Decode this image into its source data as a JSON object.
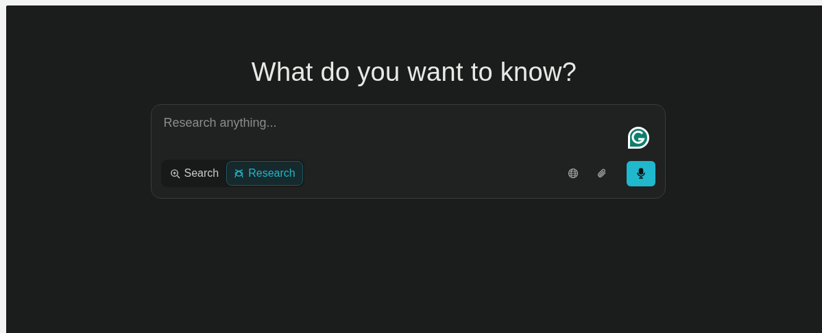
{
  "heading": "What do you want to know?",
  "query": {
    "placeholder": "Research anything..."
  },
  "modes": [
    {
      "label": "Search",
      "kind": "search",
      "selected": false
    },
    {
      "label": "Research",
      "kind": "research",
      "selected": true
    }
  ],
  "tools": [
    {
      "kind": "globe"
    },
    {
      "kind": "attach"
    },
    {
      "kind": "mic"
    }
  ]
}
